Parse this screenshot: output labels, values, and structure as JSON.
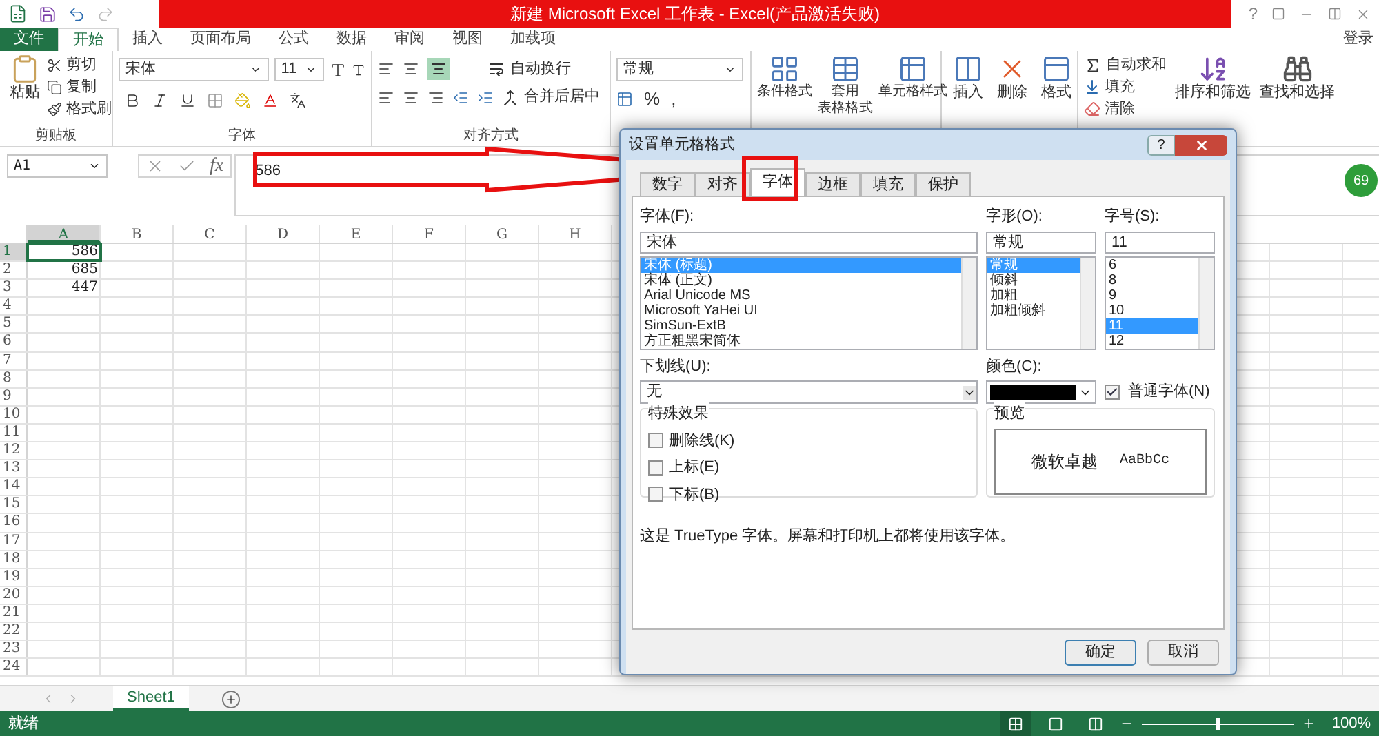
{
  "title_bar": {
    "title": "新建 Microsoft Excel 工作表 - Excel(产品激活失败)",
    "help": "?"
  },
  "ribbon_tabs": [
    {
      "label": "文件",
      "kind": "file",
      "selected": false
    },
    {
      "label": "开始",
      "kind": "tab",
      "selected": true
    },
    {
      "label": "插入",
      "kind": "tab",
      "selected": false
    },
    {
      "label": "页面布局",
      "kind": "tab",
      "selected": false
    },
    {
      "label": "公式",
      "kind": "tab",
      "selected": false
    },
    {
      "label": "数据",
      "kind": "tab",
      "selected": false
    },
    {
      "label": "审阅",
      "kind": "tab",
      "selected": false
    },
    {
      "label": "视图",
      "kind": "tab",
      "selected": false
    },
    {
      "label": "加载项",
      "kind": "tab",
      "selected": false
    }
  ],
  "sign_in": "登录",
  "ribbon": {
    "clipboard": {
      "paste": "粘贴",
      "cut": "剪切",
      "copy": "复制",
      "format_painter": "格式刷",
      "label": "剪贴板"
    },
    "font": {
      "name": "宋体",
      "size": "11",
      "label": "字体"
    },
    "alignment": {
      "wrap": "自动换行",
      "merge": "合并后居中",
      "label": "对齐方式"
    },
    "number": {
      "format": "常规",
      "percent": "%",
      "comma": ","
    },
    "styles": [
      {
        "label": "条件格式"
      },
      {
        "label": "套用",
        "label_2": "表格格式"
      },
      {
        "label": "单元格样式"
      }
    ],
    "cells": [
      {
        "label": "插入"
      },
      {
        "label": "删除"
      },
      {
        "label": "格式"
      }
    ],
    "editing": {
      "autosum": "自动求和",
      "fill": "填充",
      "clear": "清除",
      "sort": "排序和筛选",
      "find": "查找和选择"
    }
  },
  "formula_bar": {
    "name_box": "A1",
    "fx": "fx",
    "value": "586"
  },
  "side_badge": "69",
  "columns": [
    {
      "label": "A",
      "selected": true
    },
    {
      "label": "B",
      "selected": false
    },
    {
      "label": "C",
      "selected": false
    },
    {
      "label": "D",
      "selected": false
    },
    {
      "label": "E",
      "selected": false
    },
    {
      "label": "F",
      "selected": false
    },
    {
      "label": "G",
      "selected": false
    },
    {
      "label": "H",
      "selected": false
    }
  ],
  "rows": [
    {
      "label": "1",
      "value": "586",
      "selected": true
    },
    {
      "label": "2",
      "value": "685",
      "selected": false
    },
    {
      "label": "3",
      "value": "447",
      "selected": false
    },
    {
      "label": "4",
      "selected": false
    },
    {
      "label": "5",
      "selected": false
    },
    {
      "label": "6",
      "selected": false
    },
    {
      "label": "7",
      "selected": false
    },
    {
      "label": "8",
      "selected": false
    },
    {
      "label": "9",
      "selected": false
    },
    {
      "label": "10",
      "selected": false
    },
    {
      "label": "11",
      "selected": false
    },
    {
      "label": "12",
      "selected": false
    },
    {
      "label": "13",
      "selected": false
    },
    {
      "label": "14",
      "selected": false
    },
    {
      "label": "15",
      "selected": false
    },
    {
      "label": "16",
      "selected": false
    },
    {
      "label": "17",
      "selected": false
    },
    {
      "label": "18",
      "selected": false
    },
    {
      "label": "19",
      "selected": false
    },
    {
      "label": "20",
      "selected": false
    },
    {
      "label": "21",
      "selected": false
    },
    {
      "label": "22",
      "selected": false
    },
    {
      "label": "23",
      "selected": false
    },
    {
      "label": "24",
      "selected": false
    }
  ],
  "sheet_tabs": [
    {
      "label": "Sheet1",
      "selected": true
    }
  ],
  "status_bar": {
    "status": "就绪",
    "views": [
      {
        "kind": "normal",
        "selected": true
      },
      {
        "kind": "page_layout",
        "selected": false
      },
      {
        "kind": "page_break",
        "selected": false
      }
    ],
    "zoom": {
      "level": 0.5
    },
    "zoom_label": "100%"
  },
  "dialog": {
    "title": "设置单元格格式",
    "help": "?",
    "tabs": [
      {
        "label": "数字",
        "selected": false
      },
      {
        "label": "对齐",
        "selected": false
      },
      {
        "label": "字体",
        "selected": true
      },
      {
        "label": "边框",
        "selected": false
      },
      {
        "label": "填充",
        "selected": false
      },
      {
        "label": "保护",
        "selected": false
      }
    ],
    "font": {
      "label": "字体(F):",
      "value": "宋体",
      "items": [
        {
          "label": "宋体 (标题)",
          "selected": true
        },
        {
          "label": "宋体 (正文)",
          "selected": false
        },
        {
          "label": "Arial Unicode MS",
          "selected": false
        },
        {
          "label": "Microsoft YaHei UI",
          "selected": false
        },
        {
          "label": "SimSun-ExtB",
          "selected": false
        },
        {
          "label": "方正粗黑宋简体",
          "selected": false
        }
      ]
    },
    "style": {
      "label": "字形(O):",
      "value": "常规",
      "items": [
        {
          "label": "常规",
          "selected": true
        },
        {
          "label": "倾斜",
          "selected": false
        },
        {
          "label": "加粗",
          "selected": false
        },
        {
          "label": "加粗倾斜",
          "selected": false
        }
      ]
    },
    "size": {
      "label": "字号(S):",
      "value": "11",
      "items": [
        {
          "label": "6",
          "selected": false
        },
        {
          "label": "8",
          "selected": false
        },
        {
          "label": "9",
          "selected": false
        },
        {
          "label": "10",
          "selected": false
        },
        {
          "label": "11",
          "selected": true
        },
        {
          "label": "12",
          "selected": false
        }
      ]
    },
    "underline": {
      "label": "下划线(U):",
      "value": "无"
    },
    "color": {
      "label": "颜色(C):",
      "color": "#000000"
    },
    "normal_font": {
      "label": "普通字体(N)",
      "checked": true
    },
    "effects": {
      "title": "特殊效果",
      "items": [
        {
          "label": "删除线(K)",
          "checked": false
        },
        {
          "label": "上标(E)",
          "checked": false
        },
        {
          "label": "下标(B)",
          "checked": false
        }
      ]
    },
    "preview": {
      "title": "预览",
      "sample_cn": "微软卓越",
      "sample_en": "AaBbCc"
    },
    "note": "这是 TrueType 字体。屏幕和打印机上都将使用该字体。",
    "buttons": [
      {
        "label": "确定",
        "kind": "default"
      },
      {
        "label": "取消",
        "kind": "normal"
      }
    ]
  }
}
